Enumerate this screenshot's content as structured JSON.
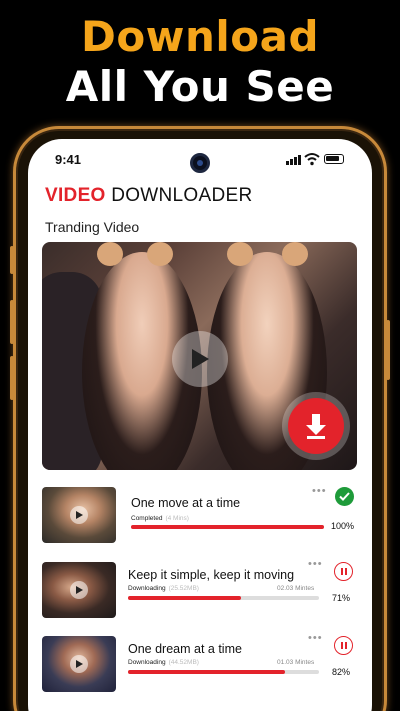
{
  "promo": {
    "line1": "Download",
    "line2": "All You See"
  },
  "status_bar": {
    "time": "9:41"
  },
  "app": {
    "title_brand": "VIDEO",
    "title_rest": " DOWNLOADER",
    "section_title": "Tranding Video"
  },
  "colors": {
    "accent": "#e3232b",
    "headline_orange": "#f5a51b",
    "success": "#1e9b3a"
  },
  "downloads": [
    {
      "title": "One move at a time",
      "status": "Completed",
      "size": "(4 Mins)",
      "minutes": "",
      "progress": 1.0,
      "percent": "100%",
      "state_icon": "check-icon"
    },
    {
      "title": "Keep it simple, keep it moving",
      "status": "Downloading",
      "size": "(25.52MB)",
      "minutes": "02.03 Mintes",
      "progress": 0.59,
      "percent": "71%",
      "state_icon": "pause-icon"
    },
    {
      "title": "One dream at a time",
      "status": "Downloading",
      "size": "(44.52MB)",
      "minutes": "01.03 Mintes",
      "progress": 0.82,
      "percent": "82%",
      "state_icon": "pause-icon"
    }
  ]
}
